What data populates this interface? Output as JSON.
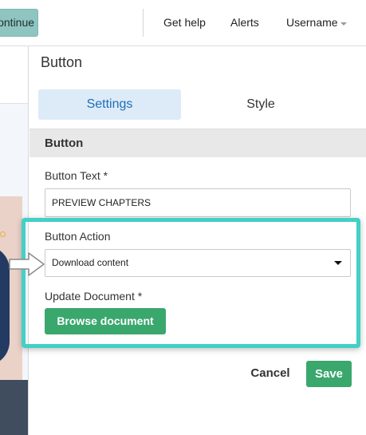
{
  "navbar": {
    "continue_label": "Continue",
    "help_label": "Get help",
    "alerts_label": "Alerts",
    "user_label": "Username"
  },
  "panel": {
    "title": "Button",
    "tabs": [
      {
        "label": "Settings",
        "active": true
      },
      {
        "label": "Style",
        "active": false
      }
    ],
    "section_title": "Button"
  },
  "form": {
    "button_text_label": "Button Text *",
    "button_text_value": "PREVIEW CHAPTERS",
    "button_action_label": "Button Action",
    "button_action_value": "Download content",
    "update_document_label": "Update Document *",
    "browse_label": "Browse document"
  },
  "footer": {
    "cancel_label": "Cancel",
    "save_label": "Save"
  },
  "colors": {
    "accent_green": "#3aa76d",
    "active_tab_bg": "#ddebf8",
    "active_tab_text": "#1e6db8",
    "highlight_border": "#43d0c6",
    "continue_bg": "#8ec5c1"
  }
}
